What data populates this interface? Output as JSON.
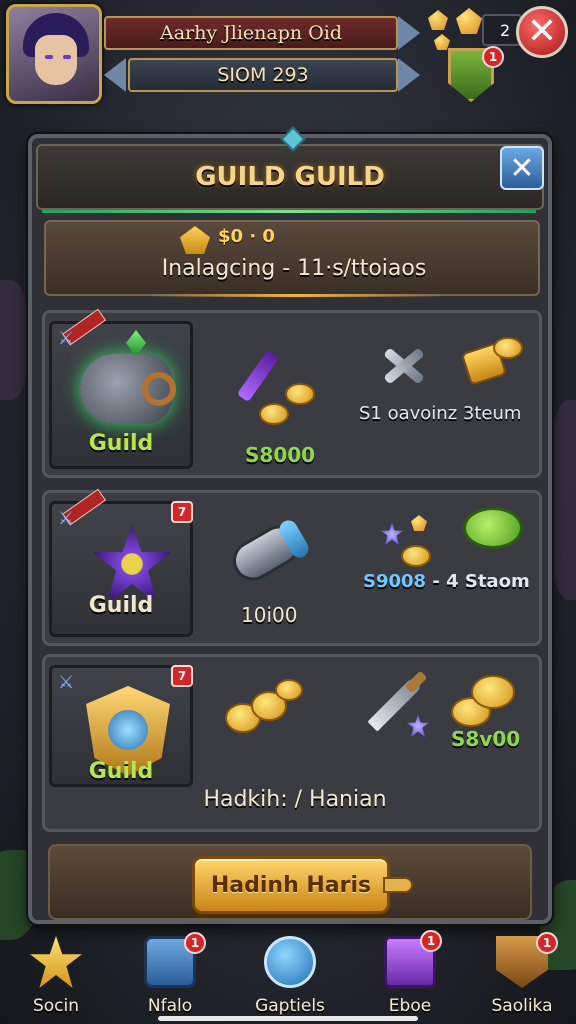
{
  "hud": {
    "player_name": "Aarhy Jlienapn Oid",
    "server_label": "SIOM 293",
    "counter": "2",
    "shield_badge_count": "1"
  },
  "panel": {
    "title": "GUILD GUILD",
    "info_amount": "$0 · 0",
    "info_subtitle": "Inalagcing - 11·s/ttoiaos"
  },
  "rows": [
    {
      "card_label": "Guild",
      "card_label_color": "#b6e84a",
      "item2_text": "S8000",
      "item2_color": "#8ed84a",
      "item3_text": "S1 oavoinz 3teum",
      "item3_color": "#dfe8f2"
    },
    {
      "card_label": "Guild",
      "card_label_color": "#f1e6c8",
      "badge": "7",
      "item2_text": "10i00",
      "item2_color": "#f1e6c8",
      "item3_text_a": "S9008",
      "item3_text_b": " - 4 Staom",
      "item3_color_a": "#6fc8ff",
      "item3_color_b": "#dfe8f2"
    },
    {
      "card_label": "Guild",
      "card_label_color": "#b6e84a",
      "badge": "7",
      "item3_text": "S8v00",
      "item3_color": "#8ed84a",
      "footer": "Hadkih: / Hanian"
    }
  ],
  "action": {
    "button_label": "Hadinh Haris"
  },
  "nav": [
    {
      "label": "Socin",
      "icon": "star-icon"
    },
    {
      "label": "Nfalo",
      "icon": "mail-icon",
      "badge": "1"
    },
    {
      "label": "Gaptiels",
      "icon": "phone-icon"
    },
    {
      "label": "Eboe",
      "icon": "shop-icon",
      "badge": "1"
    },
    {
      "label": "Saolika",
      "icon": "guild-shield-icon",
      "badge": "1"
    }
  ],
  "colors": {
    "gold": "#f5d58a",
    "green_accent": "#7ae38a",
    "close_red": "#d42626"
  }
}
